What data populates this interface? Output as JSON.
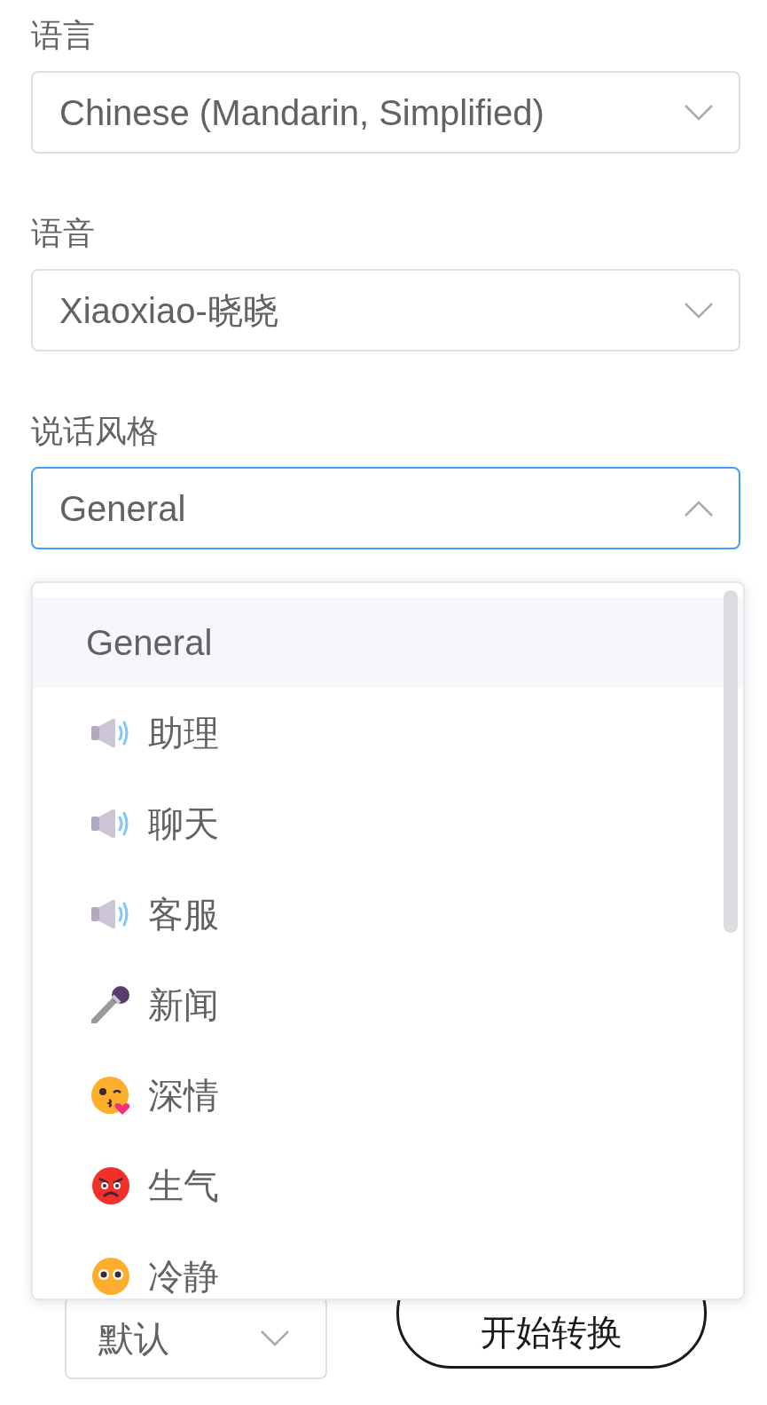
{
  "fields": [
    {
      "label": "语言",
      "value": "Chinese (Mandarin, Simplified)",
      "open": false
    },
    {
      "label": "语音",
      "value": "Xiaoxiao-晓晓",
      "open": false
    },
    {
      "label": "说话风格",
      "value": "General",
      "open": true,
      "options": [
        {
          "label": "General",
          "kind": "plain",
          "selected": true
        },
        {
          "label": "助理",
          "kind": "speaker",
          "selected": false
        },
        {
          "label": "聊天",
          "kind": "speaker",
          "selected": false
        },
        {
          "label": "客服",
          "kind": "speaker",
          "selected": false
        },
        {
          "label": "新闻",
          "kind": "microphone",
          "selected": false
        },
        {
          "label": "深情",
          "kind": "kiss-face",
          "selected": false
        },
        {
          "label": "生气",
          "kind": "angry-face",
          "selected": false
        },
        {
          "label": "冷静",
          "kind": "wide-eyed-face",
          "selected": false
        }
      ]
    }
  ],
  "bottom": {
    "select": {
      "value": "默认",
      "open": false
    },
    "button": "开始转换"
  }
}
